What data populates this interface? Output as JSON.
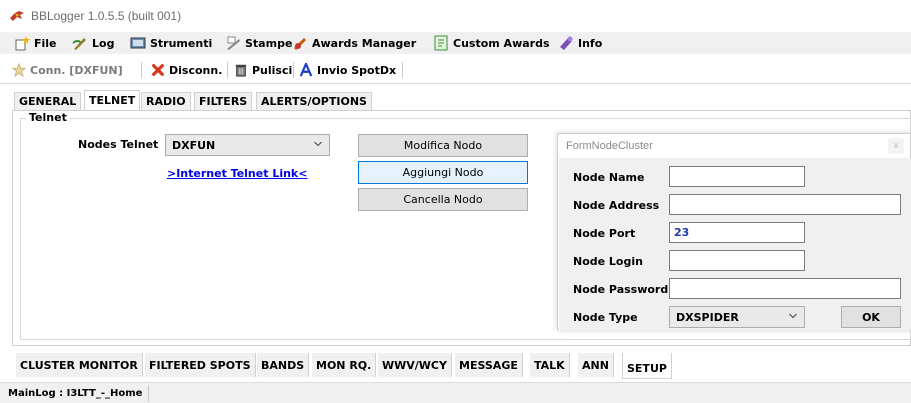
{
  "window": {
    "title": "BBLogger 1.0.5.5 (built 001)",
    "app_icon": "bird-icon"
  },
  "menu": {
    "items": [
      {
        "label": "File",
        "icon": "file-star-icon"
      },
      {
        "label": "Log",
        "icon": "quill-icon"
      },
      {
        "label": "Strumenti",
        "icon": "tools-icon"
      },
      {
        "label": "Stampe",
        "icon": "printer-icon"
      },
      {
        "label": "Awards Manager",
        "icon": "award-icon"
      },
      {
        "label": "Custom Awards",
        "icon": "document-icon"
      },
      {
        "label": "Info",
        "icon": "info-icon"
      }
    ]
  },
  "toolbar": {
    "connect": "Conn. [DXFUN]",
    "disconnect": "Disconn.",
    "clear": "Pulisci",
    "spot": "Invio SpotDx"
  },
  "top_tabs": [
    "GENERAL",
    "TELNET",
    "RADIO",
    "FILTERS",
    "ALERTS/OPTIONS"
  ],
  "active_top_tab": "TELNET",
  "telnet": {
    "group_label": "Telnet",
    "nodes_label": "Nodes Telnet",
    "nodes_value": "DXFUN",
    "link_text": ">Internet Telnet Link<",
    "btn_modify": "Modifica Nodo",
    "btn_add": "Aggiungi Nodo",
    "btn_delete": "Cancella Nodo"
  },
  "dialog": {
    "title": "FormNodeCluster",
    "close": "x",
    "name_label": "Node Name",
    "name_value": "",
    "address_label": "Node Address",
    "address_value": "",
    "port_label": "Node Port",
    "port_value": "23",
    "login_label": "Node Login",
    "login_value": "",
    "password_label": "Node Password",
    "password_value": "",
    "type_label": "Node Type",
    "type_value": "DXSPIDER",
    "ok": "OK"
  },
  "bottom_tabs": [
    "CLUSTER MONITOR",
    "FILTERED SPOTS",
    "BANDS",
    "MON RQ.",
    "WWV/WCY",
    "MESSAGE",
    "TALK",
    "ANN",
    "SETUP"
  ],
  "active_bottom_tab": "SETUP",
  "status": {
    "mainlog": "MainLog : I3LTT_-_Home"
  },
  "colors": {
    "link": "#0000ee",
    "port_value": "#1f3aa6",
    "focus_border": "#0078d7"
  }
}
